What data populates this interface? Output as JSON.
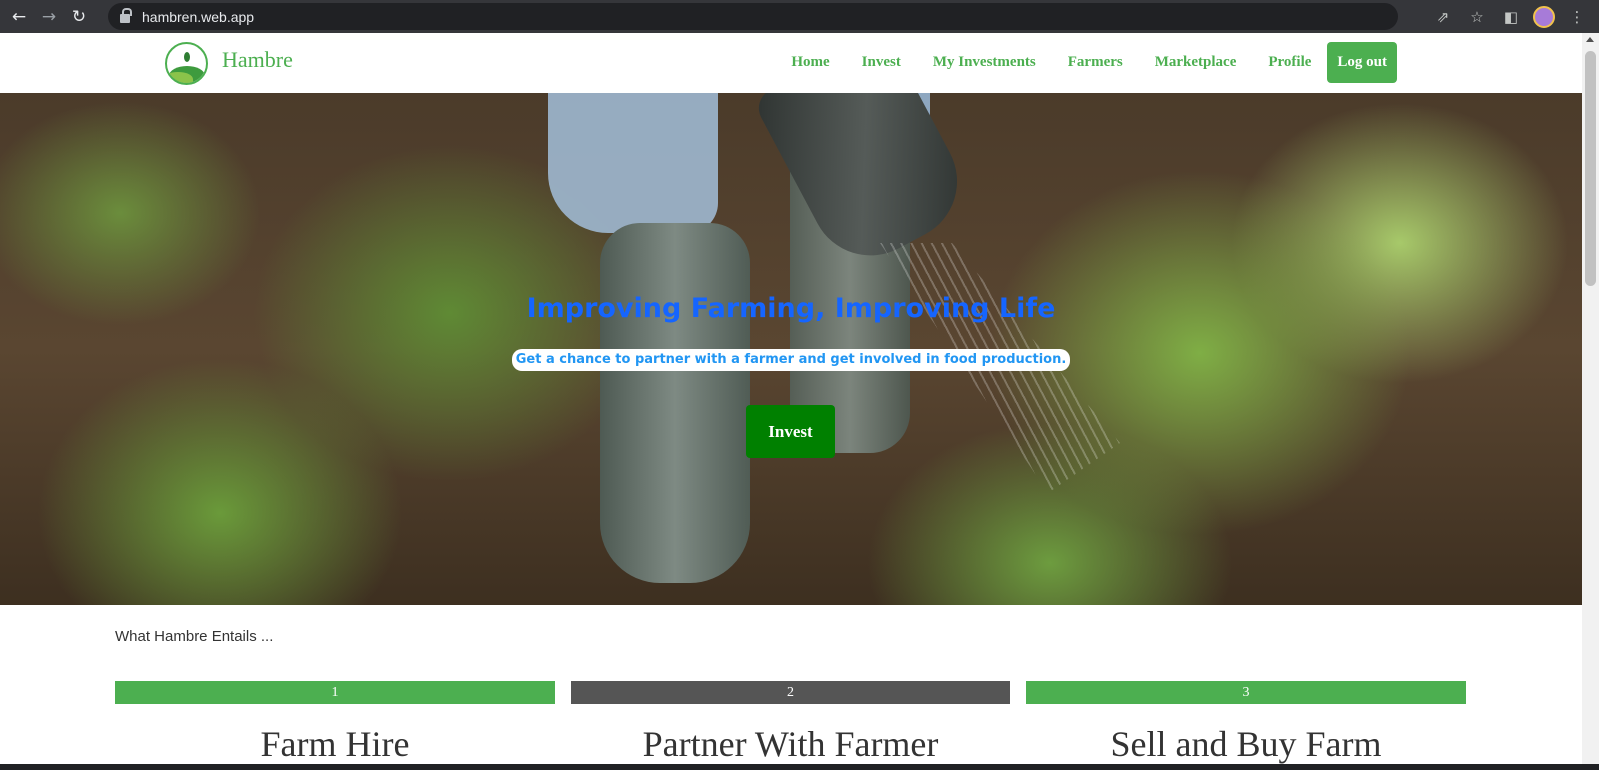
{
  "browser": {
    "url": "hambren.web.app",
    "icons": [
      "back-arrow-icon",
      "forward-arrow-icon",
      "reload-icon",
      "lock-icon",
      "share-icon",
      "star-icon",
      "side-panel-icon",
      "profile-avatar",
      "kebab-menu-icon"
    ]
  },
  "header": {
    "brand": "Hambre",
    "nav": [
      "Home",
      "Invest",
      "My Investments",
      "Farmers",
      "Marketplace",
      "Profile"
    ],
    "logout": "Log out"
  },
  "hero": {
    "title": "Improving Farming, Improving Life",
    "subtitle": "Get a chance to partner with a farmer and get involved in food production.",
    "button": "Invest"
  },
  "entails": {
    "heading": "What Hambre Entails ...",
    "steps": [
      {
        "number": "1",
        "title": "Farm Hire",
        "color": "#4caf50"
      },
      {
        "number": "2",
        "title": "Partner With Farmer",
        "color": "#555555"
      },
      {
        "number": "3",
        "title": "Sell and Buy Farm",
        "color": "#4caf50"
      }
    ]
  },
  "colors": {
    "accent": "#4caf50",
    "hero_button": "#008000",
    "hero_title": "#1565ff",
    "hero_subtitle": "#2196f3"
  }
}
